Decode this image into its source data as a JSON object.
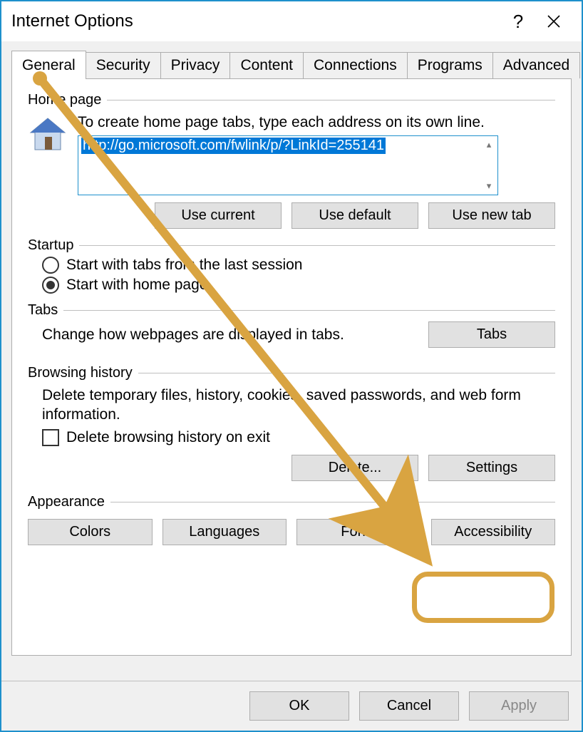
{
  "window": {
    "title": "Internet Options"
  },
  "tabs": [
    "General",
    "Security",
    "Privacy",
    "Content",
    "Connections",
    "Programs",
    "Advanced"
  ],
  "active_tab_index": 0,
  "home_page": {
    "legend": "Home page",
    "hint": "To create home page tabs, type each address on its own line.",
    "url": "http://go.microsoft.com/fwlink/p/?LinkId=255141",
    "buttons": {
      "use_current": "Use current",
      "use_default": "Use default",
      "use_new_tab": "Use new tab"
    }
  },
  "startup": {
    "legend": "Startup",
    "option_last_session": "Start with tabs from the last session",
    "option_home": "Start with home page",
    "selected": "home"
  },
  "tabs_section": {
    "legend": "Tabs",
    "desc": "Change how webpages are displayed in tabs.",
    "button": "Tabs"
  },
  "history": {
    "legend": "Browsing history",
    "desc": "Delete temporary files, history, cookies, saved passwords, and web form information.",
    "checkbox_label": "Delete browsing history on exit",
    "checkbox_checked": false,
    "delete_button": "Delete...",
    "settings_button": "Settings"
  },
  "appearance": {
    "legend": "Appearance",
    "colors": "Colors",
    "languages": "Languages",
    "fonts": "Fonts",
    "accessibility": "Accessibility"
  },
  "footer": {
    "ok": "OK",
    "cancel": "Cancel",
    "apply": "Apply"
  }
}
